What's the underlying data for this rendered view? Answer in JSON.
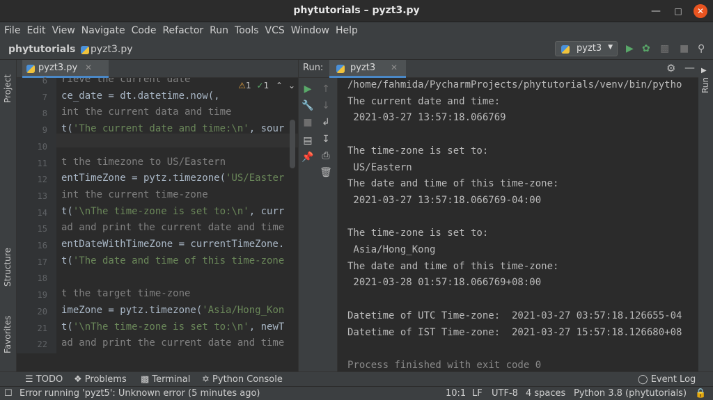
{
  "window": {
    "title": "phytutorials – pyzt3.py"
  },
  "menu": [
    "File",
    "Edit",
    "View",
    "Navigate",
    "Code",
    "Refactor",
    "Run",
    "Tools",
    "VCS",
    "Window",
    "Help"
  ],
  "breadcrumb": {
    "project": "phytutorials",
    "file": "pyzt3.py"
  },
  "run_config": {
    "label": "pyzt3"
  },
  "left_strip": {
    "project": "Project",
    "structure": "Structure",
    "favorites": "Favorites"
  },
  "right_strip": {
    "run": "Run"
  },
  "editor": {
    "tab": "pyzt3.py",
    "inspection": {
      "warnings": "1",
      "weak_warnings": "1"
    },
    "lines": [
      {
        "n": "6",
        "text": "rieve the current date"
      },
      {
        "n": "7",
        "text": "ce_date = dt.datetime.now(,"
      },
      {
        "n": "8",
        "text": "int the current data and time"
      },
      {
        "n": "9",
        "text": "t('The current date and time:\\n', sour"
      },
      {
        "n": "10",
        "text": ""
      },
      {
        "n": "11",
        "text": "t the timezone to US/Eastern"
      },
      {
        "n": "12",
        "text": "entTimeZone = pytz.timezone('US/Easter"
      },
      {
        "n": "13",
        "text": "int the current time-zone"
      },
      {
        "n": "14",
        "text": "t('\\nThe time-zone is set to:\\n', curr"
      },
      {
        "n": "15",
        "text": "ad and print the current date and time"
      },
      {
        "n": "16",
        "text": "entDateWithTimeZone = currentTimeZone."
      },
      {
        "n": "17",
        "text": "t('The date and time of this time-zone"
      },
      {
        "n": "18",
        "text": ""
      },
      {
        "n": "19",
        "text": "t the target time-zone"
      },
      {
        "n": "20",
        "text": "imeZone = pytz.timezone('Asia/Hong_Kon"
      },
      {
        "n": "21",
        "text": "t('\\nThe time-zone is set to:\\n', newT"
      },
      {
        "n": "22",
        "text": "ad and print the current date and time"
      }
    ]
  },
  "run": {
    "label": "Run:",
    "tab": "pyzt3",
    "output": [
      "/home/fahmida/PycharmProjects/phytutorials/venv/bin/pytho",
      "The current date and time:",
      " 2021-03-27 13:57:18.066769",
      "",
      "The time-zone is set to:",
      " US/Eastern",
      "The date and time of this time-zone:",
      " 2021-03-27 13:57:18.066769-04:00",
      "",
      "The time-zone is set to:",
      " Asia/Hong_Kong",
      "The date and time of this time-zone:",
      " 2021-03-28 01:57:18.066769+08:00",
      "",
      "Datetime of UTC Time-zone:  2021-03-27 03:57:18.126655-04",
      "Datetime of IST Time-zone:  2021-03-27 15:57:18.126680+08",
      "",
      "Process finished with exit code 0"
    ]
  },
  "bottom_tabs": {
    "todo": "TODO",
    "problems": "Problems",
    "terminal": "Terminal",
    "python_console": "Python Console",
    "event_log": "Event Log"
  },
  "status": {
    "message": "Error running 'pyzt5': Unknown error (5 minutes ago)",
    "position": "10:1",
    "line_sep": "LF",
    "encoding": "UTF-8",
    "indent": "4 spaces",
    "interpreter": "Python 3.8 (phytutorials)"
  },
  "colors": {
    "accent": "#4a88c7",
    "run_green": "#59a869",
    "close_orange": "#e95420"
  }
}
